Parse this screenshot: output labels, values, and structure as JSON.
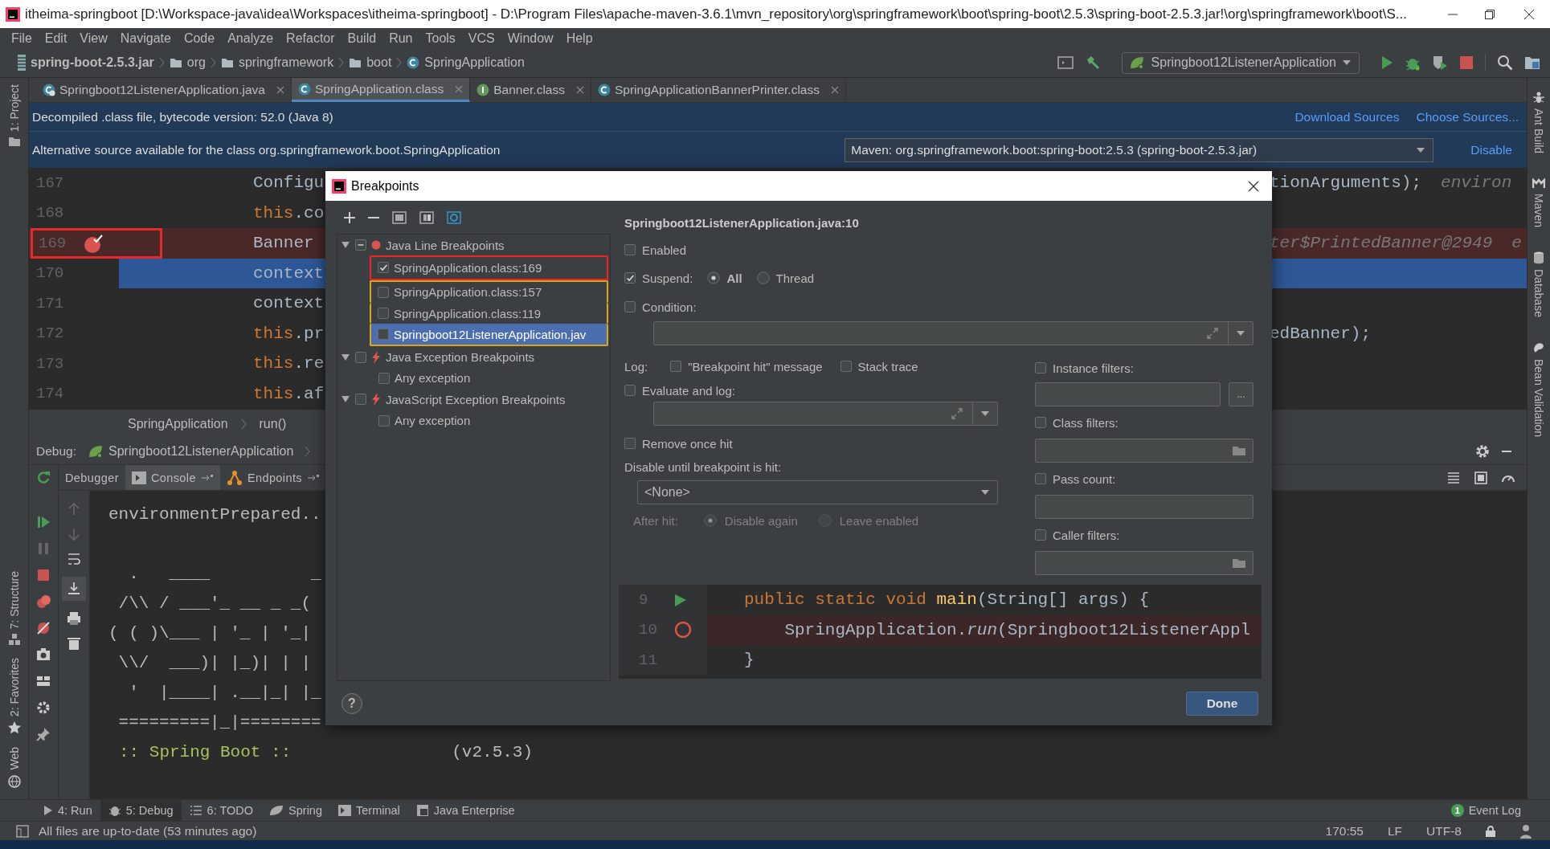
{
  "title_bar": {
    "title": "itheima-springboot [D:\\Workspace-java\\idea\\Workspaces\\itheima-springboot] - D:\\Program Files\\apache-maven-3.6.1\\mvn_repository\\org\\springframework\\boot\\spring-boot\\2.5.3\\spring-boot-2.5.3.jar!\\org\\springframework\\boot\\S..."
  },
  "menu": [
    "File",
    "Edit",
    "View",
    "Navigate",
    "Code",
    "Analyze",
    "Refactor",
    "Build",
    "Run",
    "Tools",
    "VCS",
    "Window",
    "Help"
  ],
  "navigation_bar": {
    "path": [
      {
        "label": "spring-boot-2.5.3.jar",
        "kind": "jar"
      },
      {
        "label": "org",
        "kind": "folder"
      },
      {
        "label": "springframework",
        "kind": "folder"
      },
      {
        "label": "boot",
        "kind": "folder"
      },
      {
        "label": "SpringApplication",
        "kind": "class"
      }
    ],
    "run_configuration": "Springboot12ListenerApplication"
  },
  "left_tool_windows": {
    "top": [
      {
        "label": "1: Project",
        "kind": "project"
      }
    ],
    "bottom": [
      {
        "label": "7: Structure",
        "kind": "structure"
      },
      {
        "label": "2: Favorites",
        "kind": "favorites"
      },
      {
        "label": "Web",
        "kind": "web"
      }
    ]
  },
  "right_tool_windows": [
    {
      "label": "Ant Build",
      "kind": "ant"
    },
    {
      "label": "Maven",
      "kind": "maven"
    },
    {
      "label": "Database",
      "kind": "database"
    },
    {
      "label": "Bean Validation",
      "kind": "bean"
    }
  ],
  "editor_tabs": [
    {
      "label": "Springboot12ListenerApplication.java",
      "kind": "app",
      "selected": false
    },
    {
      "label": "SpringApplication.class",
      "kind": "class",
      "selected": true
    },
    {
      "label": "Banner.class",
      "kind": "interface",
      "selected": false
    },
    {
      "label": "SpringApplicationBannerPrinter.class",
      "kind": "class",
      "selected": false
    }
  ],
  "decompiled_notice": {
    "text": "Decompiled .class file, bytecode version: 52.0 (Java 8)",
    "links": [
      "Download Sources",
      "Choose Sources..."
    ]
  },
  "source_notice": {
    "text": "Alternative source available for the class org.springframework.boot.SpringApplication",
    "source": "Maven: org.springframework.boot:spring-boot:2.5.3 (spring-boot-2.5.3.jar)",
    "link": "Disable"
  },
  "editor": {
    "lines": [
      {
        "number": "167",
        "left": [
          {
            "text": "Configu",
            "kind": "plain"
          }
        ],
        "right": [
          {
            "text": "tionArguments);",
            "kind": "plain"
          },
          {
            "text": "environ",
            "kind": "hint"
          }
        ],
        "breakpoint": false,
        "selected": false,
        "outlined": false
      },
      {
        "number": "168",
        "left": [
          {
            "text": "this",
            "kind": "keyword"
          },
          {
            "text": ".co",
            "kind": "plain"
          }
        ],
        "breakpoint": false,
        "selected": false,
        "outlined": false
      },
      {
        "number": "169",
        "left": [
          {
            "text": "Banner",
            "kind": "plain"
          }
        ],
        "right": [
          {
            "text": "ter$PrintedBanner@2949",
            "kind": "hint"
          },
          {
            "text": "e",
            "kind": "hint"
          }
        ],
        "breakpoint": true,
        "selected": false,
        "outlined": true,
        "color": "#e52a2a"
      },
      {
        "number": "170",
        "left": [
          {
            "text": "context",
            "kind": "plain"
          }
        ],
        "breakpoint": false,
        "selected": true,
        "outlined": false
      },
      {
        "number": "171",
        "left": [
          {
            "text": "context",
            "kind": "plain"
          }
        ],
        "breakpoint": false,
        "selected": false,
        "outlined": false
      },
      {
        "number": "172",
        "left": [
          {
            "text": "this",
            "kind": "keyword"
          },
          {
            "text": ".pr",
            "kind": "plain"
          }
        ],
        "right": [
          {
            "text": "edBanner);",
            "kind": "plain"
          }
        ],
        "breakpoint": false,
        "selected": false,
        "outlined": false
      },
      {
        "number": "173",
        "left": [
          {
            "text": "this",
            "kind": "keyword"
          },
          {
            "text": ".re",
            "kind": "plain"
          }
        ],
        "breakpoint": false,
        "selected": false,
        "outlined": false
      },
      {
        "number": "174",
        "left": [
          {
            "text": "this",
            "kind": "keyword"
          },
          {
            "text": ".af",
            "kind": "plain"
          }
        ],
        "breakpoint": false,
        "selected": false,
        "outlined": false
      }
    ]
  },
  "editor_breadcrumb": [
    "SpringApplication",
    "run()"
  ],
  "debug": {
    "label": "Debug:",
    "session": "Springboot12ListenerApplication",
    "tabs": [
      {
        "label": "Debugger",
        "kind": "debugger",
        "selected": false
      },
      {
        "label": "Console",
        "kind": "console",
        "selected": true
      },
      {
        "label": "Endpoints",
        "kind": "endpoints",
        "selected": false
      }
    ],
    "console": {
      "first_line": "environmentPrepared..",
      "banner": [
        "  .   ____          _",
        " /\\\\ / ___'_ __ _ _(",
        "( ( )\\___ | '_ | '_|",
        " \\\\/  ___)| |_)| | |",
        "  '  |____| .__|_| |_",
        " =========|_|========"
      ],
      "footer": {
        "label": ":: Spring Boot ::",
        "version": "(v2.5.3)"
      }
    }
  },
  "breakpoints_dialog": {
    "title": "Breakpoints",
    "tree": [
      {
        "label": "Java Line Breakpoints",
        "kind": "line",
        "expanded": true,
        "checked": false,
        "partial": true,
        "selected": false,
        "children": [
          {
            "label": "SpringApplication.class:169",
            "checked": true,
            "selected": false,
            "outlined": true,
            "color": "#f02424"
          },
          {
            "label": "SpringApplication.class:157",
            "checked": false,
            "selected": false,
            "outlined": true,
            "color": "#d9a520"
          },
          {
            "label": "SpringApplication.class:119",
            "checked": false,
            "selected": false,
            "outlined": true,
            "color": "#d9a520"
          },
          {
            "label": "Springboot12ListenerApplication.jav",
            "checked": false,
            "selected": true,
            "outlined": true,
            "color": "#d9a520"
          }
        ]
      },
      {
        "label": "Java Exception Breakpoints",
        "kind": "exception",
        "expanded": true,
        "checked": false,
        "partial": false,
        "selected": false,
        "children": [
          {
            "label": "Any exception",
            "checked": false,
            "selected": false,
            "outlined": false
          }
        ]
      },
      {
        "label": "JavaScript Exception Breakpoints",
        "kind": "exception",
        "expanded": true,
        "checked": false,
        "partial": false,
        "selected": false,
        "children": [
          {
            "label": "Any exception",
            "checked": false,
            "selected": false,
            "outlined": false
          }
        ]
      }
    ],
    "details": {
      "heading": "Springboot12ListenerApplication.java:10",
      "enabled": {
        "label": "Enabled",
        "checked": false
      },
      "suspend": {
        "label": "Suspend:",
        "checked": true,
        "options": [
          {
            "label": "All",
            "selected": true
          },
          {
            "label": "Thread",
            "selected": false
          }
        ]
      },
      "condition": {
        "label": "Condition:",
        "checked": false
      },
      "log": {
        "label": "Log:",
        "options": [
          {
            "label": "\"Breakpoint hit\" message",
            "checked": false
          },
          {
            "label": "Stack trace",
            "checked": false
          }
        ]
      },
      "evaluate": {
        "label": "Evaluate and log:",
        "checked": false
      },
      "remove_once_hit": {
        "label": "Remove once hit",
        "checked": false
      },
      "disable_until": {
        "label": "Disable until breakpoint is hit:",
        "value": "<None>"
      },
      "after_hit": {
        "label": "After hit:",
        "disabled": true,
        "options": [
          {
            "label": "Disable again",
            "selected": true
          },
          {
            "label": "Leave enabled",
            "selected": false
          }
        ]
      },
      "filters": [
        {
          "label": "Instance filters:",
          "checked": false,
          "kind": "more",
          "button": "..."
        },
        {
          "label": "Class filters:",
          "checked": false,
          "kind": "browse"
        },
        {
          "label": "Pass count:",
          "checked": false,
          "kind": "plain"
        },
        {
          "label": "Caller filters:",
          "checked": false,
          "kind": "browse"
        }
      ]
    },
    "preview": [
      {
        "number": "9",
        "run_marker": true,
        "breakpoint": false,
        "tokens": [
          {
            "text": "public static void ",
            "kind": "keyword"
          },
          {
            "text": "main",
            "kind": "method"
          },
          {
            "text": "(String[] args) {",
            "kind": "plain"
          }
        ]
      },
      {
        "number": "10",
        "run_marker": false,
        "breakpoint": true,
        "tokens": [
          {
            "text": "    SpringApplication.",
            "kind": "plain"
          },
          {
            "text": "run",
            "kind": "italic"
          },
          {
            "text": "(Springboot12ListenerAppl",
            "kind": "plain"
          }
        ]
      },
      {
        "number": "11",
        "run_marker": false,
        "breakpoint": false,
        "tokens": [
          {
            "text": "}",
            "kind": "plain"
          }
        ]
      }
    ],
    "help": "?",
    "done": "Done"
  },
  "bottom_tabs": [
    {
      "label": "4: Run",
      "kind": "run",
      "selected": false
    },
    {
      "label": "5: Debug",
      "kind": "debug",
      "selected": true
    },
    {
      "label": "6: TODO",
      "kind": "todo",
      "selected": false
    },
    {
      "label": "Spring",
      "kind": "spring",
      "selected": false
    },
    {
      "label": "Terminal",
      "kind": "terminal",
      "selected": false
    },
    {
      "label": "Java Enterprise",
      "kind": "enterprise",
      "selected": false
    }
  ],
  "event_log": {
    "label": "Event Log",
    "count": "1"
  },
  "status_bar": {
    "message": "All files are up-to-date (53 minutes ago)",
    "position": "170:55",
    "line_separator": "LF",
    "encoding": "UTF-8"
  }
}
